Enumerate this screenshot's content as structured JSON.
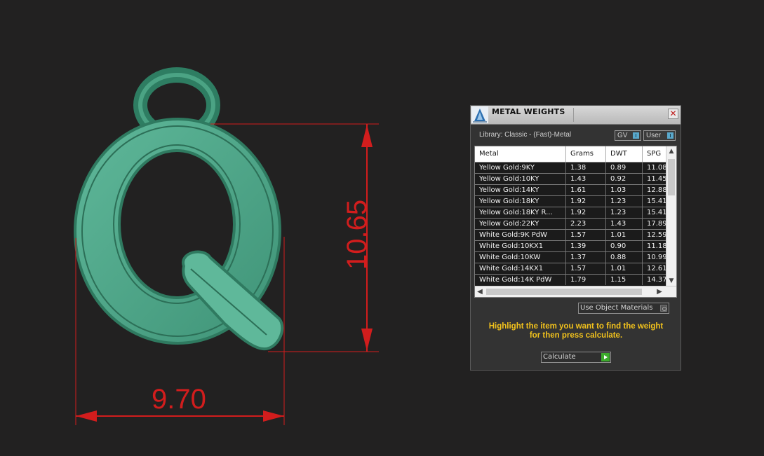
{
  "viewport": {
    "model": "letter-Q-pendant",
    "dimensions": {
      "width": "9.70",
      "height": "10.65"
    },
    "colors": {
      "dimension": "#d21d1d",
      "model": "#3d9a7a"
    }
  },
  "panel": {
    "title": "METAL WEIGHTS",
    "close_icon": "close-icon",
    "library_label": "Library: Classic - (Fast)-Metal",
    "toggles": [
      {
        "label": "GV"
      },
      {
        "label": "User"
      }
    ],
    "table": {
      "headers": [
        "Metal",
        "Grams",
        "DWT",
        "SPG"
      ],
      "rows": [
        [
          "Yellow Gold:9KY",
          "1.38",
          "0.89",
          "11.08"
        ],
        [
          "Yellow Gold:10KY",
          "1.43",
          "0.92",
          "11.45"
        ],
        [
          "Yellow Gold:14KY",
          "1.61",
          "1.03",
          "12.88"
        ],
        [
          "Yellow Gold:18KY",
          "1.92",
          "1.23",
          "15.41"
        ],
        [
          "Yellow Gold:18KY R...",
          "1.92",
          "1.23",
          "15.41"
        ],
        [
          "Yellow Gold:22KY",
          "2.23",
          "1.43",
          "17.89"
        ],
        [
          "White Gold:9K PdW",
          "1.57",
          "1.01",
          "12.59"
        ],
        [
          "White Gold:10KX1",
          "1.39",
          "0.90",
          "11.18"
        ],
        [
          "White Gold:10KW",
          "1.37",
          "0.88",
          "10.99"
        ],
        [
          "White Gold:14KX1",
          "1.57",
          "1.01",
          "12.61"
        ],
        [
          "White Gold:14K PdW",
          "1.79",
          "1.15",
          "14.37"
        ]
      ]
    },
    "use_object_materials": "Use Object Materials",
    "instructions_line1": "Highlight the item you want to find the weight",
    "instructions_line2": "for then press calculate.",
    "calculate_label": "Calculate",
    "accent": "#f2c21c"
  }
}
